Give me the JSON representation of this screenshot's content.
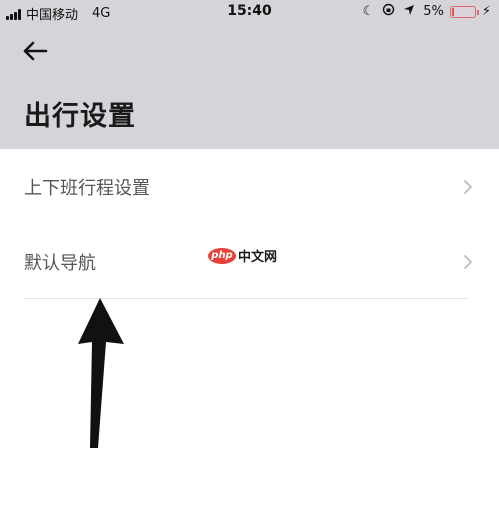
{
  "status_bar": {
    "carrier": "中国移动",
    "network": "4G",
    "time": "15:40",
    "battery_percent": "5%",
    "battery_level": 0.05,
    "icons": [
      "signal-icon",
      "moon-icon",
      "rotation-lock-icon",
      "location-icon",
      "battery-icon",
      "charging-bolt-icon"
    ]
  },
  "header": {
    "back_icon": "back-arrow-icon",
    "title": "出行设置"
  },
  "list": {
    "items": [
      {
        "label": "上下班行程设置",
        "icon": "chevron-right-icon"
      },
      {
        "label": "默认导航",
        "icon": "chevron-right-icon"
      }
    ]
  },
  "watermark": {
    "logo": "php",
    "text": "中文网"
  },
  "colors": {
    "header_bg": "#d6d4d9",
    "page_bg": "#ffffff",
    "battery_low": "#e05050",
    "watermark_red": "#e8413a"
  }
}
